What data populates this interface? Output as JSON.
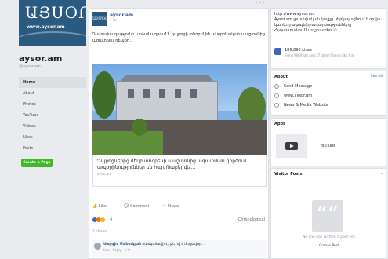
{
  "page": {
    "cover_logo": "ԱՅՍՕՐ",
    "cover_url": "www.aysor.am",
    "name": "aysor.am",
    "handle": "@aysor.am"
  },
  "nav": {
    "items": [
      "Home",
      "About",
      "Photos",
      "YouTube",
      "Videos",
      "Likes",
      "Posts"
    ],
    "create_label": "Create a Page"
  },
  "post": {
    "author": "aysor.am",
    "time": "1 hr · ",
    "text": "Դատախազությունն արձանագրում է՝ դպրոցի տնօրենին անօրինական պաշտոնից ազատելու դեպքը...",
    "link_title": "Դպրոցներից մեկի տնօրենի պաշտոնից ազատման գործում ապօրինություններ են հայտնաբերվել...",
    "link_domain": "aysor.am",
    "actions": {
      "like": "Like",
      "comment": "Comment",
      "share": "Share"
    },
    "reaction_count": "4",
    "sort_label": "Chronological",
    "shares_text": "2 shares",
    "comment": {
      "author": "Սարգիս Մանուկյան",
      "text": "հասկանալի է, թե ով է մեղավոր...",
      "meta": "Like · Reply · 1 hr"
    }
  },
  "sidebar": {
    "about_url": "http://www.aysor.am",
    "about_text": "Aysor.am լրատվական կայքը ներկայացնում է օրվա կարևորագույն իրադարձությունները Հայաստանում և աշխարհում:",
    "likes_count": "186,896 Likes",
    "likes_sub": "Elena Melikyan and 37 other friends like this",
    "about_head": "About",
    "see_all": "See All",
    "about_rows": [
      "Send Message",
      "www.aysor.am",
      "News & Media Website"
    ],
    "apps_head": "Apps",
    "apps_item": "YouTube",
    "visitor_head": "Visitor Posts",
    "visitor_empty": "No one has written a post yet.",
    "create_post": "Create Post"
  },
  "colors": {
    "brand": "#2b5a80",
    "link": "#365899",
    "green": "#42b72a",
    "background": "#e9ebee"
  }
}
